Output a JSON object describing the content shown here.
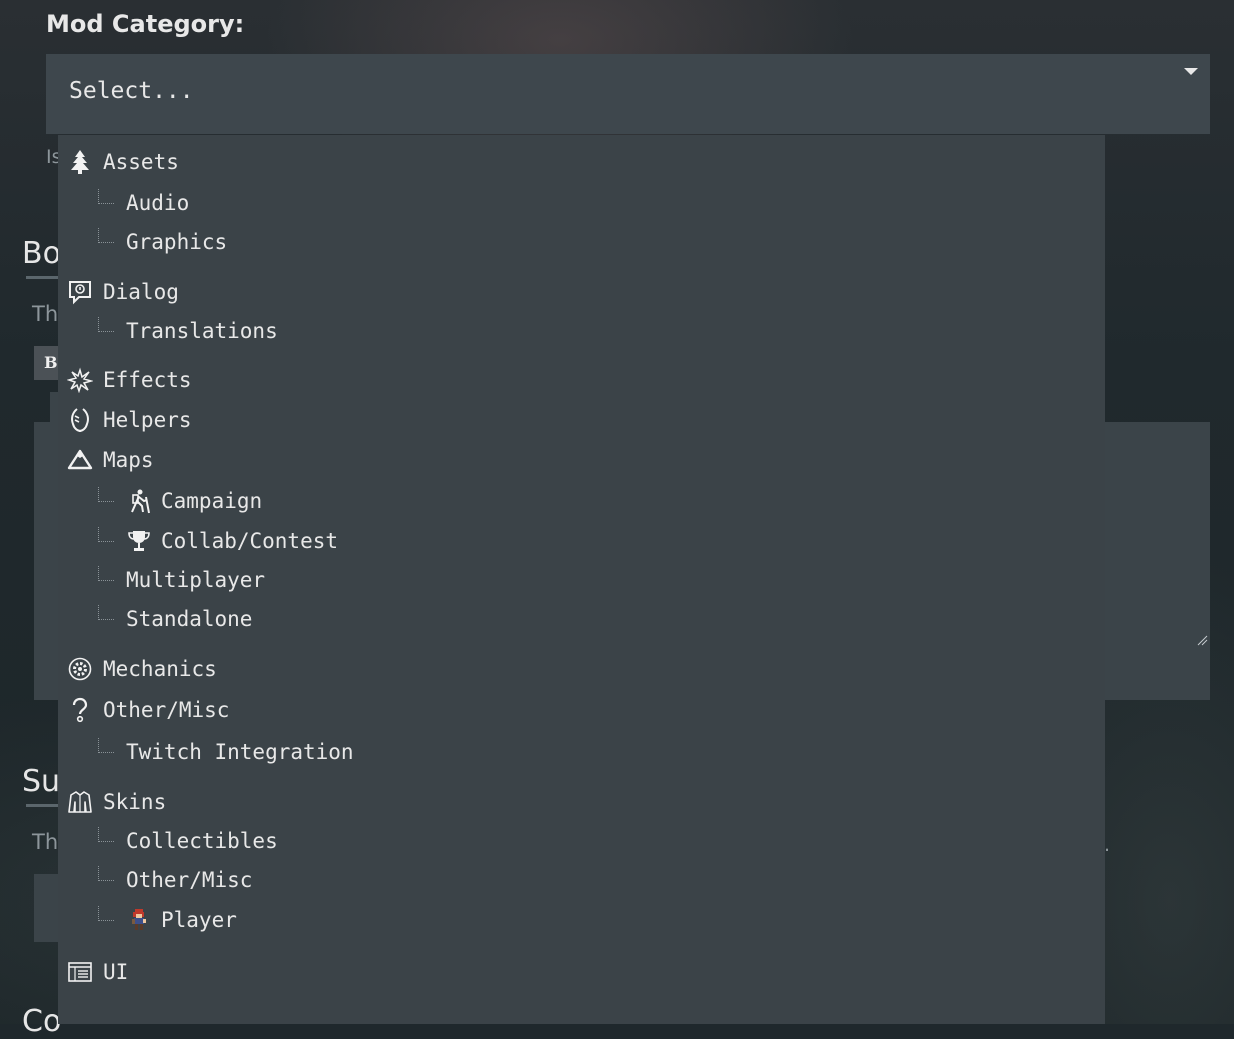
{
  "form": {
    "category_label": "Mod Category:",
    "select_placeholder": "Select...",
    "bg_hint_top": "Is",
    "bg_heading_1": "Bo",
    "bg_text_1": "Th",
    "bg_button": "B",
    "bg_heading_2": "Su",
    "bg_text_2": "Th",
    "bg_trailing_dot": ".",
    "bg_heading_3": "Co"
  },
  "options": [
    {
      "label": "Assets",
      "level": 0,
      "icon": "tree-icon"
    },
    {
      "label": "Audio",
      "level": 1
    },
    {
      "label": "Graphics",
      "level": 1
    },
    {
      "label": "Dialog",
      "level": 0,
      "icon": "speech-bubble-icon"
    },
    {
      "label": "Translations",
      "level": 1
    },
    {
      "label": "Effects",
      "level": 0,
      "icon": "splash-icon"
    },
    {
      "label": "Helpers",
      "level": 0,
      "icon": "helping-hand-icon"
    },
    {
      "label": "Maps",
      "level": 0,
      "icon": "mountain-icon"
    },
    {
      "label": "Campaign",
      "level": 1,
      "icon": "hiker-icon"
    },
    {
      "label": "Collab/Contest",
      "level": 1,
      "icon": "trophy-icon"
    },
    {
      "label": "Multiplayer",
      "level": 1
    },
    {
      "label": "Standalone",
      "level": 1
    },
    {
      "label": "Mechanics",
      "level": 0,
      "icon": "gear-icon"
    },
    {
      "label": "Other/Misc",
      "level": 0,
      "icon": "question-mark-icon"
    },
    {
      "label": "Twitch Integration",
      "level": 1
    },
    {
      "label": "Skins",
      "level": 0,
      "icon": "jacket-icon"
    },
    {
      "label": "Collectibles",
      "level": 1
    },
    {
      "label": "Other/Misc",
      "level": 1
    },
    {
      "label": "Player",
      "level": 1,
      "icon": "player-sprite-icon"
    },
    {
      "label": "UI",
      "level": 0,
      "icon": "window-list-icon"
    }
  ],
  "colors": {
    "select_bg": "#3e474d",
    "dropdown_bg": "#3b4348",
    "page_bg": "#1f282c",
    "text": "#e8e8e8"
  }
}
